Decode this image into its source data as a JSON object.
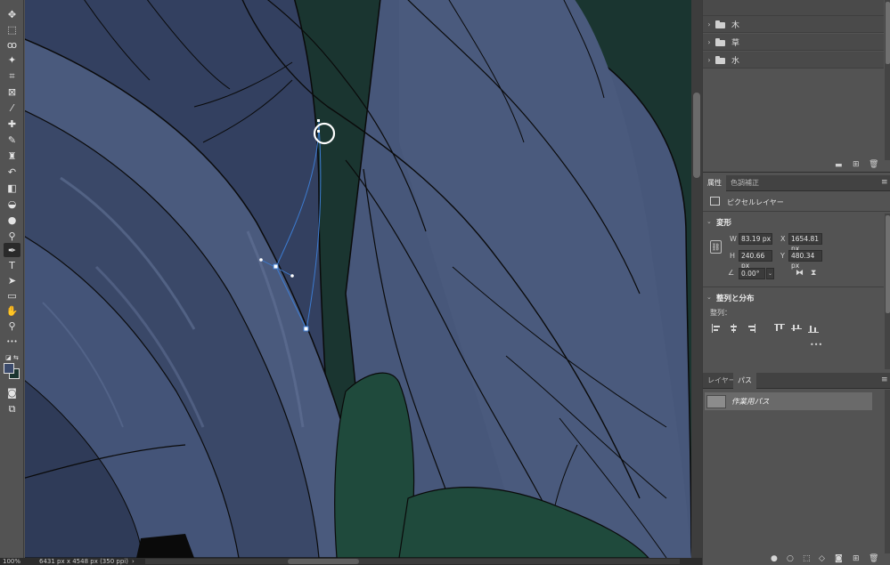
{
  "toolbar": {
    "tools": [
      {
        "name": "move-tool-icon",
        "glyph": "✥"
      },
      {
        "name": "marquee-tool-icon",
        "glyph": "⬚"
      },
      {
        "name": "lasso-tool-icon",
        "glyph": "ꝏ"
      },
      {
        "name": "magic-wand-tool-icon",
        "glyph": "✦"
      },
      {
        "name": "crop-tool-icon",
        "glyph": "⌗"
      },
      {
        "name": "frame-tool-icon",
        "glyph": "⊠"
      },
      {
        "name": "eyedropper-tool-icon",
        "glyph": "⁄"
      },
      {
        "name": "healing-brush-tool-icon",
        "glyph": "✚"
      },
      {
        "name": "brush-tool-icon",
        "glyph": "✎"
      },
      {
        "name": "stamp-tool-icon",
        "glyph": "♜"
      },
      {
        "name": "history-brush-tool-icon",
        "glyph": "↶"
      },
      {
        "name": "eraser-tool-icon",
        "glyph": "◧"
      },
      {
        "name": "paint-bucket-tool-icon",
        "glyph": "◒"
      },
      {
        "name": "blur-tool-icon",
        "glyph": "●"
      },
      {
        "name": "dodge-tool-icon",
        "glyph": "⚲"
      },
      {
        "name": "pen-tool-icon",
        "glyph": "✒"
      },
      {
        "name": "type-tool-icon",
        "glyph": "T"
      },
      {
        "name": "path-selection-tool-icon",
        "glyph": "➤"
      },
      {
        "name": "rectangle-tool-icon",
        "glyph": "▭"
      },
      {
        "name": "hand-tool-icon",
        "glyph": "✋"
      },
      {
        "name": "zoom-tool-icon",
        "glyph": "⚲"
      },
      {
        "name": "more-tools-icon",
        "glyph": "•••"
      }
    ],
    "lower_tools": [
      {
        "name": "quick-mask-icon",
        "glyph": "◙"
      },
      {
        "name": "screen-mode-icon",
        "glyph": "⧉"
      }
    ],
    "colors": {
      "foreground": "#3b4a6b",
      "background": "#1a3530"
    }
  },
  "status": {
    "zoom": "100%",
    "doc_size": "6431 px x 4548 px (350 ppi)",
    "arrow": "›"
  },
  "layers_top": {
    "groups": [
      {
        "label": "木"
      },
      {
        "label": "草"
      },
      {
        "label": "水"
      }
    ]
  },
  "properties": {
    "tabs": [
      {
        "label": "属性",
        "active": true
      },
      {
        "label": "色調補正",
        "active": false
      }
    ],
    "layer_type": "ピクセルレイヤー",
    "transform": {
      "title": "変形",
      "w_label": "W",
      "w_value": "83.19 px",
      "h_label": "H",
      "h_value": "240.66 px",
      "x_label": "X",
      "x_value": "1654.81 px",
      "y_label": "Y",
      "y_value": "480.34 px",
      "angle_value": "0.00°"
    },
    "align": {
      "title": "整列と分布",
      "sub_label": "整列：",
      "more": "•••"
    }
  },
  "paths_panel": {
    "tabs": [
      {
        "label": "レイヤー",
        "active": false
      },
      {
        "label": "パス",
        "active": true
      }
    ],
    "items": [
      {
        "label": "作業用パス"
      }
    ]
  }
}
